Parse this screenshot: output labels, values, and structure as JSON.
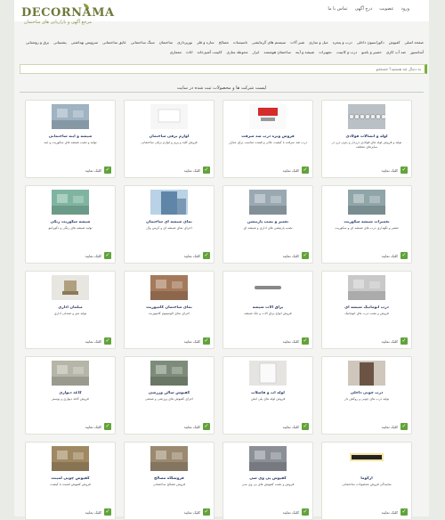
{
  "header": {
    "logo": "DECORNAMA",
    "logo_sub": "مرجع آگهی و بازاریابی های ساختمان",
    "top_nav": [
      "ورود",
      "عضویت",
      "درج آگهی",
      "تماس با ما"
    ]
  },
  "menu": [
    "صفحه اصلی",
    "کفپوش",
    "دکوراسیون داخلی",
    "درب و پنجره",
    "مبل و سازی",
    "شیر آلات",
    "سیستم های گرمایشی",
    "تاسیسات",
    "مصالح",
    "سازه و فلز",
    "نورپردازی",
    "ساختمان",
    "سنگ ساختمانی",
    "عایق ساختمانی",
    "سرویس بهداشتی",
    "پشتیبانی",
    "برق و روشنایی",
    "آسانسور",
    "ضد آب کاری",
    "حصیر و بامبو",
    "درب و کابینت",
    "تجهیزات",
    "شیشه و آینه",
    "ساختمان هوشمند",
    "ابزار",
    "محوطه سازی",
    "کابینت آشپزخانه",
    "اثاث",
    "معماری"
  ],
  "search": {
    "placeholder": "به دنبال چه هستید؟ جستجو"
  },
  "heading": "لیست شرکت ها و محصولات ثبت شده در سایت",
  "more_label": "کلیک نمایید",
  "cards": [
    {
      "title": "لوله و اتصالات فولادی",
      "desc": "تولید و فروش لوله های فولادی درزدار و بدون درز در سایزهای مختلف",
      "thumb": "pipes",
      "color": "#b9c0c6"
    },
    {
      "title": "فروش ویژه درب ضد سرقت",
      "desc": "درب ضد سرقت با کیفیت عالی و قیمت مناسب برای منازل",
      "thumb": "sale",
      "color": "#d9d9d9"
    },
    {
      "title": "لوازم برقی ساختمان",
      "desc": "فروش کلید و پریز و لوازم برقی ساختمانی",
      "thumb": "white",
      "color": "#eeeeee"
    },
    {
      "title": "شیشه و آینه ساختمانی",
      "desc": "تولید و نصب شیشه های سکوریت و آینه",
      "thumb": "lab",
      "color": "#9fb3c2"
    },
    {
      "title": "تعمیرات شیشه سکوریت",
      "desc": "تعمیر و نگهداری درب های شیشه ای و سکوریت",
      "thumb": "room",
      "color": "#8fa5a8"
    },
    {
      "title": "تعمیر و نصب پارتیشن",
      "desc": "نصب پارتیشن های اداری و شیشه ای",
      "thumb": "office",
      "color": "#9aa8b2"
    },
    {
      "title": "نمای شیشه ای ساختمان",
      "desc": "اجرای نمای شیشه ای و کرتین وال",
      "thumb": "tower",
      "color": "#5f86a8"
    },
    {
      "title": "شیشه سکوریت رنگی",
      "desc": "تولید شیشه های رنگی و دکوراتیو",
      "thumb": "green",
      "color": "#7fb5a0"
    },
    {
      "title": "درب اتوماتیک شیشه ای",
      "desc": "فروش و نصب درب های اتوماتیک",
      "thumb": "interior",
      "color": "#c9c9c9"
    },
    {
      "title": "یراق آلات شیشه",
      "desc": "فروش انواع یراق آلات و جک شیشه",
      "thumb": "hinge",
      "color": "#888888"
    },
    {
      "title": "نمای ساختمان کامپوزیت",
      "desc": "اجرای نمای آلومینیوم کامپوزیت",
      "thumb": "building",
      "color": "#a57a5a"
    },
    {
      "title": "مبلمان اداری",
      "desc": "تولید میز و صندلی اداری",
      "thumb": "chair",
      "color": "#b0a080"
    },
    {
      "title": "درب چوبی داخلی",
      "desc": "تولید درب های چوبی و روکش دار",
      "thumb": "door",
      "color": "#6b5444"
    },
    {
      "title": "لوله آب و فاضلاب",
      "desc": "فروش لوله های پلی اتیلن",
      "thumb": "white2",
      "color": "#e6e4e0"
    },
    {
      "title": "کفپوش سالن ورزشی",
      "desc": "اجرای کفپوش های ورزشی و صنعتی",
      "thumb": "gym",
      "color": "#7d8c7a"
    },
    {
      "title": "کاغذ دیواری",
      "desc": "فروش کاغذ دیواری و پوستر",
      "thumb": "bed",
      "color": "#b5b5a8"
    },
    {
      "title": "آرکوما",
      "desc": "نمایندگی فروش محصولات ساختمانی",
      "thumb": "logo",
      "color": "#f3e6a4"
    },
    {
      "title": "کفپوش پی وی سی",
      "desc": "فروش و نصب کفپوش های پی وی سی",
      "thumb": "hall",
      "color": "#8b8f96"
    },
    {
      "title": "فروشگاه مصالح",
      "desc": "فروش مصالح ساختمانی",
      "thumb": "shop",
      "color": "#9b8a70"
    },
    {
      "title": "کفپوش چوبی لمینت",
      "desc": "فروش کفپوش لمینت با کیفیت",
      "thumb": "floor",
      "color": "#a08862"
    }
  ]
}
